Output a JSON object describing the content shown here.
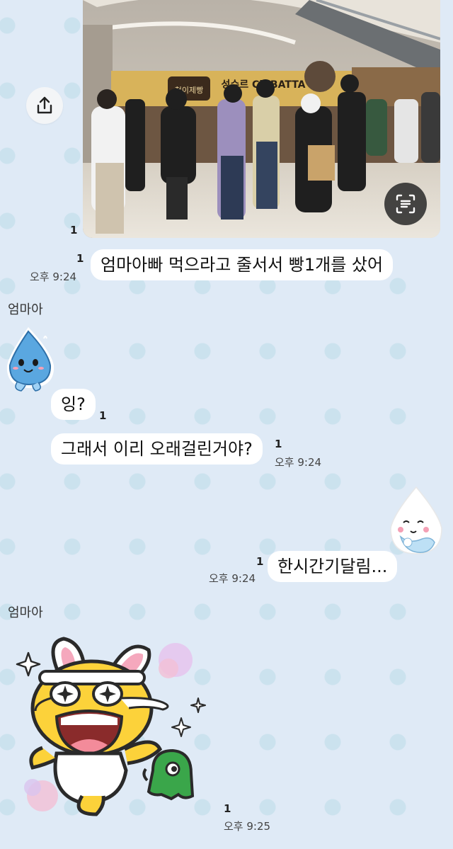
{
  "photo": {
    "sign_text": "성수르 CiABATTA",
    "logo_text": "천이제빵"
  },
  "icons": {
    "share": "share-icon",
    "scan": "scan-text-icon"
  },
  "messages": [
    {
      "id": "m1",
      "side": "right",
      "type": "image",
      "read": "1"
    },
    {
      "id": "m2",
      "side": "right",
      "type": "text",
      "text": "엄마아빠 먹으라고 줄서서 빵1개를 샀어",
      "read": "1",
      "time": "오후 9:24"
    },
    {
      "id": "m3",
      "side": "left",
      "sender": "엄마아",
      "type": "sticker",
      "sticker": "water-drop-sticker"
    },
    {
      "id": "m4",
      "side": "left",
      "type": "text",
      "text": "잉?",
      "read": "1"
    },
    {
      "id": "m5",
      "side": "left",
      "type": "text",
      "text": "그래서 이리 오래걸린거야?",
      "read": "1",
      "time": "오후 9:24"
    },
    {
      "id": "m6",
      "side": "right",
      "type": "sticker",
      "sticker": "white-drop-sticker"
    },
    {
      "id": "m7",
      "side": "right",
      "type": "text",
      "text": "한시간기달림...",
      "read": "1",
      "time": "오후 9:24"
    },
    {
      "id": "m8",
      "side": "left",
      "sender": "엄마아",
      "type": "sticker",
      "sticker": "rabbit-crying-sticker",
      "read": "1",
      "time": "오후 9:25"
    }
  ],
  "colors": {
    "background": "#dfeaf6",
    "bubble": "#ffffff",
    "dot": "#cbe2ee"
  }
}
